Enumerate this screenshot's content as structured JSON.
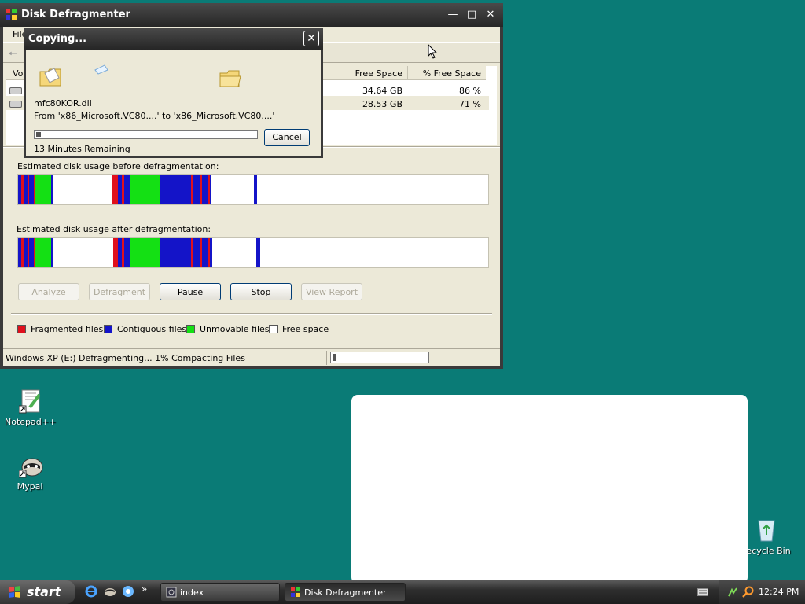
{
  "window": {
    "title": "Disk Defragmenter",
    "menu_first": "File",
    "columns": [
      "Vol",
      "Free Space",
      "% Free Space"
    ],
    "rows": [
      {
        "free": "34.64 GB",
        "pct": "86 %"
      },
      {
        "free": "28.53 GB",
        "pct": "71 %"
      }
    ],
    "before_label": "Estimated disk usage before defragmentation:",
    "after_label": "Estimated disk usage after defragmentation:",
    "buttons": {
      "analyze": "Analyze",
      "defragment": "Defragment",
      "pause": "Pause",
      "stop": "Stop",
      "view_report": "View Report"
    },
    "legend": [
      {
        "label": "Fragmented files",
        "color": "#e0101c"
      },
      {
        "label": "Contiguous files",
        "color": "#1414c8"
      },
      {
        "label": "Unmovable files",
        "color": "#14e014"
      },
      {
        "label": "Free space",
        "color": "#ffffff"
      }
    ],
    "status_text": "Windows XP (E:) Defragmenting... 1%  Compacting Files",
    "progress_fraction": 0.01
  },
  "dialog": {
    "title": "Copying...",
    "filename": "mfc80KOR.dll",
    "from_line": "From 'x86_Microsoft.VC80....' to 'x86_Microsoft.VC80....'",
    "remaining": "13 Minutes Remaining",
    "cancel": "Cancel",
    "progress_fraction": 0.02
  },
  "desktop": {
    "icons": [
      "Notepad++",
      "Mypal",
      "Recycle Bin"
    ]
  },
  "taskbar": {
    "start": "start",
    "tasks": [
      "index",
      "Disk Defragmenter"
    ],
    "clock": "12:24 PM",
    "chevron": "»"
  },
  "colors": {
    "desktop": "#0a7b76",
    "fragmented": "#e0101c",
    "contiguous": "#1414c8",
    "unmovable": "#14e014"
  }
}
